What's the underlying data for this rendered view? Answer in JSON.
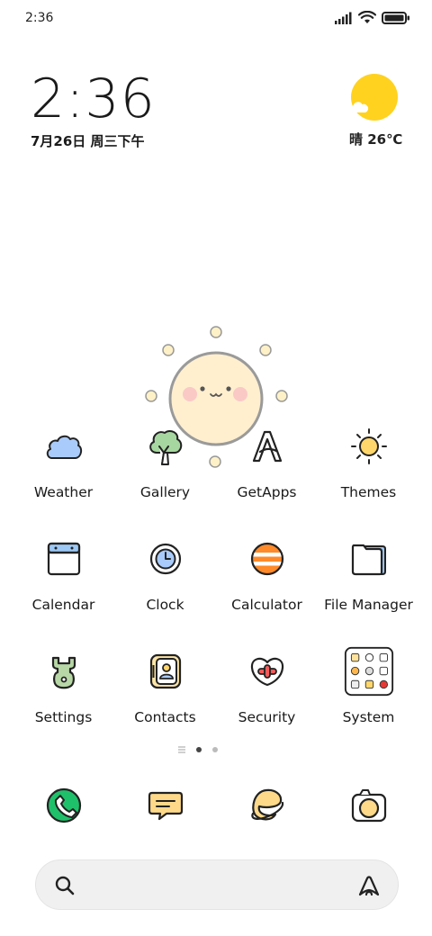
{
  "status_bar": {
    "time": "2:36"
  },
  "clock_widget": {
    "time": "2:36",
    "date": "7月26日 周三下午"
  },
  "weather_widget": {
    "text": "晴 26℃"
  },
  "apps": [
    {
      "label": "Weather",
      "icon": "cloud-icon"
    },
    {
      "label": "Gallery",
      "icon": "tree-icon"
    },
    {
      "label": "GetApps",
      "icon": "getapps-a-icon"
    },
    {
      "label": "Themes",
      "icon": "sun-icon"
    },
    {
      "label": "Calendar",
      "icon": "calendar-icon"
    },
    {
      "label": "Clock",
      "icon": "clock-icon"
    },
    {
      "label": "Calculator",
      "icon": "calculator-icon"
    },
    {
      "label": "File Manager",
      "icon": "folder-icon"
    },
    {
      "label": "Settings",
      "icon": "settings-icon"
    },
    {
      "label": "Contacts",
      "icon": "contacts-icon"
    },
    {
      "label": "Security",
      "icon": "security-icon"
    },
    {
      "label": "System",
      "icon": "system-folder-icon"
    }
  ],
  "dock": [
    {
      "icon": "phone-icon"
    },
    {
      "icon": "messages-icon"
    },
    {
      "icon": "browser-icon"
    },
    {
      "icon": "camera-icon"
    }
  ],
  "page_indicator": {
    "pages": 2,
    "active": 1
  },
  "colors": {
    "sun_yellow": "#FFD21F",
    "phone_green": "#1FC06A",
    "calc_orange": "#FF8A2A",
    "msg_yellow": "#FFD98A"
  }
}
